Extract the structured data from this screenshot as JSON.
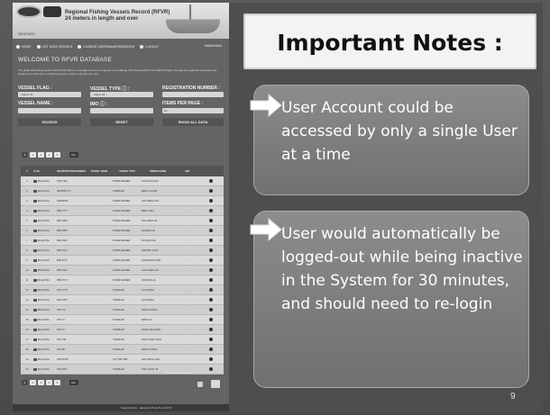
{
  "screenshot": {
    "banner": {
      "title_line1": "Regional Fishing Vessels Record (RFVR)",
      "title_line2": "24 meters in length and over",
      "site_label": "SEAFDEC"
    },
    "nav": {
      "items": [
        "HOME",
        "LIST DATA VESSELS",
        "CHANGE USERNAME/PASSWORD",
        "LOGOUT"
      ],
      "user_label": "MAIMUNAH"
    },
    "welcome": "WELCOME TO RFVR DATABASE",
    "intro": "The Regional Fishing Vessel Record (RFVR) is a management tool to support in combating IUU Fishing within the ASEAN Region through the regional cooperation by sharing the information of fishing vessels of 24m in length and over.",
    "form": {
      "vessel_flag_label": "VESSEL FLAG :",
      "vessel_flag_value": "- Select All -",
      "vessel_type_label": "VESSEL TYPE ⓘ :",
      "vessel_type_value": "- Select All -",
      "registration_number_label": "REGISTRATION NUMBER :",
      "vessel_name_label": "VESSEL NAME :",
      "imo_label": "IMO ⓘ :",
      "items_per_page_label": "ITEMS PER PAGE :",
      "items_per_page_value": "20",
      "search_button": "SEARCH",
      "reset_button": "RESET",
      "show_all_button": "SHOW ALL DATA"
    },
    "pager_top": {
      "pages": [
        "1",
        "2",
        "3",
        "4",
        "5"
      ],
      "ellipsis": "...",
      "go_label": "GO"
    },
    "table": {
      "headers": [
        "#",
        "FLAG",
        "REGISTRATION NUMBER",
        "VESSEL NAME",
        "VESSEL TYPE",
        "OWNER NAME",
        "IMO",
        ""
      ],
      "rows": [
        {
          "no": "1",
          "flag": "MALAYSIA",
          "reg": "KNF 7191",
          "type": "PURSE SEINER",
          "owner": "FOOLOW KING",
          "imo": "-"
        },
        {
          "no": "2",
          "flag": "MALAYSIA",
          "reg": "JHF5555 G P",
          "type": "TRAWLER",
          "owner": "BENG CHUAN",
          "imo": "-"
        },
        {
          "no": "3",
          "flag": "MALAYSIA",
          "reg": "PKFB4000",
          "type": "PURSE SEINER",
          "owner": "HAN SENG HIN",
          "imo": "-"
        },
        {
          "no": "4",
          "flag": "MALAYSIA",
          "reg": "PBF 7777",
          "type": "PURSE SEINER",
          "owner": "BENG SEN",
          "imo": "-"
        },
        {
          "no": "5",
          "flag": "MALAYSIA",
          "reg": "PBF 9085",
          "type": "PURSE SEINER",
          "owner": "TAN HENG HA",
          "imo": "-"
        },
        {
          "no": "6",
          "flag": "MALAYSIA",
          "reg": "PBF 9085",
          "type": "PURSE SEINER",
          "owner": "LIM BAN LAI",
          "imo": "-"
        },
        {
          "no": "7",
          "flag": "MALAYSIA",
          "reg": "PBF 5006",
          "type": "PURSE SEINER",
          "owner": "NG CHIN SIA",
          "imo": "-"
        },
        {
          "no": "8",
          "flag": "MALAYSIA",
          "reg": "PBF 9213",
          "type": "PURSE SEINER",
          "owner": "KEE BIN CHUA",
          "imo": "-"
        },
        {
          "no": "9",
          "flag": "MALAYSIA",
          "reg": "PBF 8172",
          "type": "PURSE SEINER",
          "owner": "JAWANSIAN SDN",
          "imo": "-"
        },
        {
          "no": "10",
          "flag": "MALAYSIA",
          "reg": "PBF 2102",
          "type": "PURSE SEINER",
          "owner": "GOH CHEE TAT",
          "imo": "-"
        },
        {
          "no": "11",
          "flag": "MALAYSIA",
          "reg": "PBF 8172",
          "type": "PURSE SEINER",
          "owner": "LIM BOH LIA",
          "imo": "-"
        },
        {
          "no": "12",
          "flag": "MALAYSIA",
          "reg": "SFS 1776",
          "type": "TRAWLER",
          "owner": "LIAN HENG",
          "imo": "-"
        },
        {
          "no": "13",
          "flag": "MALAYSIA",
          "reg": "SFS 6752",
          "type": "TRAWLER",
          "owner": "LIAN HENG",
          "imo": "-"
        },
        {
          "no": "14",
          "flag": "MALAYSIA",
          "reg": "SFS 7/3",
          "type": "TRAWLER",
          "owner": "SENG FUONG",
          "imo": "-"
        },
        {
          "no": "15",
          "flag": "MALAYSIA",
          "reg": "SFS 77",
          "type": "TRAWLER",
          "owner": "SENG FA",
          "imo": "-"
        },
        {
          "no": "16",
          "flag": "MALAYSIA",
          "reg": "SFS 77",
          "type": "TRAWLER",
          "owner": "HONG HIN CHAN",
          "imo": "-"
        },
        {
          "no": "17",
          "flag": "MALAYSIA",
          "reg": "SFS 780",
          "type": "TRAWLER",
          "owner": "TENG KHIN LUAN",
          "imo": "-"
        },
        {
          "no": "18",
          "flag": "MALAYSIA",
          "reg": "SFS 88",
          "type": "TRAWLER",
          "owner": "SENG FUONG",
          "imo": "-"
        },
        {
          "no": "19",
          "flag": "MALAYSIA",
          "reg": "SFS 91 B2",
          "type": "LIFT NETTER",
          "owner": "HAN TENG SIAN",
          "imo": "-"
        },
        {
          "no": "20",
          "flag": "MALAYSIA",
          "reg": "SFS 2002",
          "type": "TRAWLER",
          "owner": "TING HOCK JN",
          "imo": "-"
        }
      ]
    },
    "results": "Results : 2123 Vessels",
    "footer": "Supported by : Japanese Trust Fund (JTF)"
  },
  "slide": {
    "title": "Important Notes :",
    "notes": [
      "User Account could be accessed by only a single User at a time",
      "User would automatically be logged-out while being inactive in the System for 30 minutes, and should need to re-login"
    ],
    "page_number": "9"
  },
  "colors": {
    "background": "#505050",
    "note_box": "#808080",
    "title_box": "#f3f3f3"
  }
}
